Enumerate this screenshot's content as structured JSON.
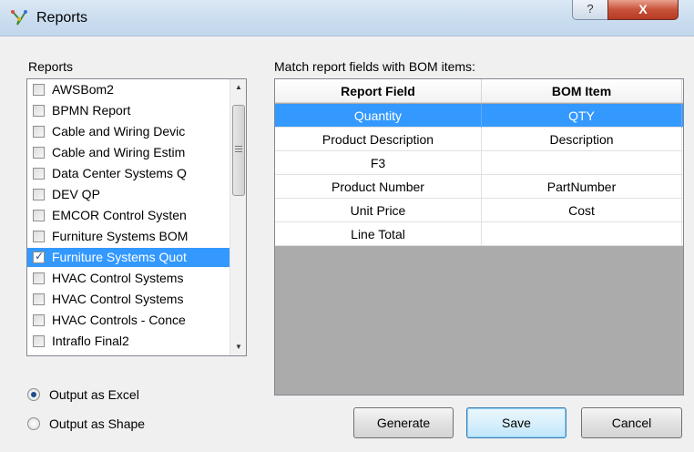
{
  "window": {
    "title": "Reports",
    "help_label": "?",
    "close_label": "X"
  },
  "reports": {
    "label": "Reports",
    "items": [
      {
        "label": "AWSBom2",
        "checked": false,
        "selected": false
      },
      {
        "label": "BPMN Report",
        "checked": false,
        "selected": false
      },
      {
        "label": "Cable and Wiring Devic",
        "checked": false,
        "selected": false
      },
      {
        "label": "Cable and Wiring Estim",
        "checked": false,
        "selected": false
      },
      {
        "label": "Data Center Systems Q",
        "checked": false,
        "selected": false
      },
      {
        "label": "DEV QP",
        "checked": false,
        "selected": false
      },
      {
        "label": "EMCOR Control Systen",
        "checked": false,
        "selected": false
      },
      {
        "label": "Furniture Systems BOM",
        "checked": false,
        "selected": false
      },
      {
        "label": "Furniture Systems Quot",
        "checked": true,
        "selected": true
      },
      {
        "label": "HVAC Control Systems",
        "checked": false,
        "selected": false
      },
      {
        "label": "HVAC Control Systems",
        "checked": false,
        "selected": false
      },
      {
        "label": "HVAC Controls - Conce",
        "checked": false,
        "selected": false
      },
      {
        "label": "Intraflo Final2",
        "checked": false,
        "selected": false
      }
    ]
  },
  "output": {
    "excel_label": "Output as Excel",
    "shape_label": "Output as Shape",
    "selected": "excel"
  },
  "mapping": {
    "label": "Match report fields with BOM items:",
    "headers": {
      "field": "Report Field",
      "bom": "BOM Item"
    },
    "rows": [
      {
        "field": "Quantity",
        "bom": "QTY",
        "selected": true
      },
      {
        "field": "Product Description",
        "bom": "Description",
        "selected": false
      },
      {
        "field": "F3",
        "bom": "",
        "selected": false
      },
      {
        "field": "Product Number",
        "bom": "PartNumber",
        "selected": false
      },
      {
        "field": "Unit Price",
        "bom": "Cost",
        "selected": false
      },
      {
        "field": "Line Total",
        "bom": "",
        "selected": false
      }
    ]
  },
  "buttons": {
    "generate": "Generate",
    "save": "Save",
    "cancel": "Cancel"
  },
  "colors": {
    "selection": "#3399ff",
    "grid_background": "#ababab",
    "dialog_background": "#f0f0f0"
  }
}
